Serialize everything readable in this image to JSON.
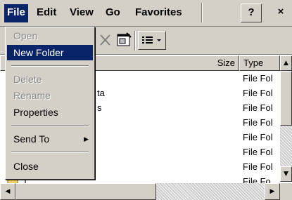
{
  "menubar": {
    "items": [
      "File",
      "Edit",
      "View",
      "Go",
      "Favorites"
    ],
    "help_label": "?",
    "close_label": "×"
  },
  "list": {
    "columns": {
      "size": "Size",
      "type": "Type"
    },
    "rows": [
      {
        "name": "",
        "type": "File Fol"
      },
      {
        "name": "ta",
        "type": "File Fol"
      },
      {
        "name": "s",
        "type": "File Fol"
      },
      {
        "name": "",
        "type": "File Fol"
      },
      {
        "name": "",
        "type": "File Fol"
      },
      {
        "name": "",
        "type": "File Fol"
      },
      {
        "name": "",
        "type": "File Fol"
      },
      {
        "name": "T",
        "type": "File Fo"
      }
    ]
  },
  "file_menu": {
    "open": "Open",
    "new_folder": "New Folder",
    "delete": "Delete",
    "rename": "Rename",
    "properties": "Properties",
    "send_to": "Send To",
    "close": "Close"
  },
  "colors": {
    "highlight": "#0a246a",
    "face": "#d4d0c8"
  }
}
